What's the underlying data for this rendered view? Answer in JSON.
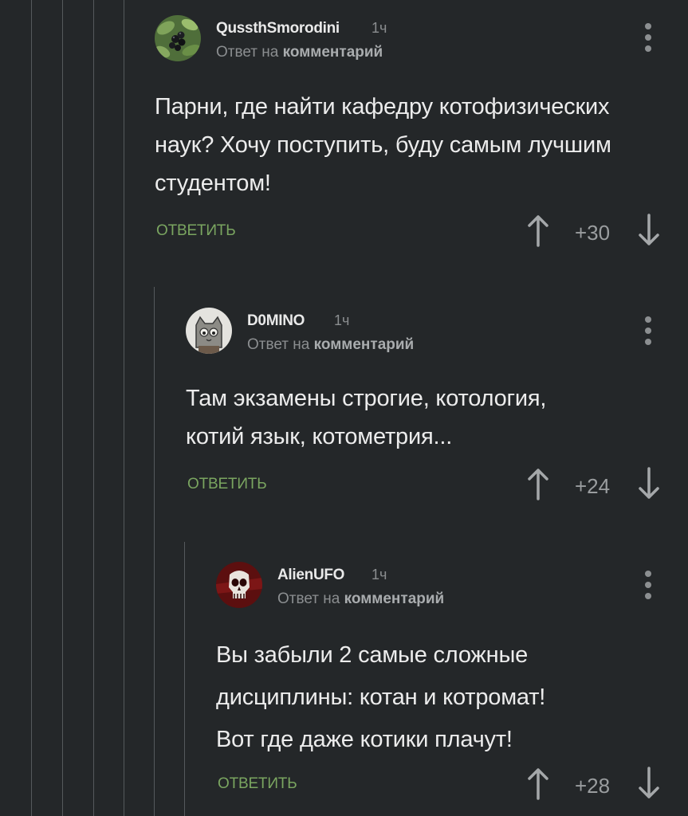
{
  "colors": {
    "background": "#242729",
    "thread_line": "#55595c",
    "reply_link": "#7aa560",
    "muted_text": "#8b8e90"
  },
  "comments": [
    {
      "username": "QussthSmorodini",
      "time": "1ч",
      "reply_prefix": "Ответ на",
      "reply_target": "комментарий",
      "text_lines": [
        "Парни, где найти кафедру котофизических",
        "наук? Хочу поступить, буду самым лучшим",
        "студентом!"
      ],
      "reply_label": "ответить",
      "score": "+30",
      "avatar_icon": "berries-avatar-icon"
    },
    {
      "username": "D0MINO",
      "time": "1ч",
      "reply_prefix": "Ответ на",
      "reply_target": "комментарий",
      "text_lines": [
        "Там экзамены строгие, котология,",
        "котий язык, котометрия..."
      ],
      "reply_label": "ответить",
      "score": "+24",
      "avatar_icon": "cat-avatar-icon"
    },
    {
      "username": "AlienUFO",
      "time": "1ч",
      "reply_prefix": "Ответ на",
      "reply_target": "комментарий",
      "text_lines": [
        "Вы забыли 2 самые сложные",
        "дисциплины: котан и котромат!",
        "Вот где даже котики плачут!"
      ],
      "reply_label": "ответить",
      "score": "+28",
      "avatar_icon": "skull-avatar-icon"
    }
  ]
}
